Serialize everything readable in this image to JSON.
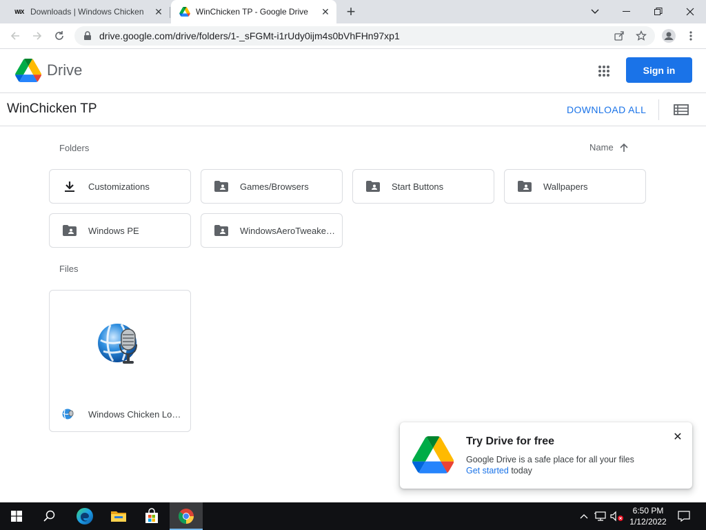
{
  "browser": {
    "tabs": [
      {
        "title": "Downloads | Windows Chicken",
        "favicon": "wix-favicon",
        "active": false
      },
      {
        "title": "WinChicken TP - Google Drive",
        "favicon": "google-drive-favicon",
        "active": true
      }
    ],
    "url": "drive.google.com/drive/folders/1-_sFGMt-i1rUdy0ijm4s0bVhFHn97xp1"
  },
  "drive": {
    "logo_text": "Drive",
    "signin_label": "Sign in",
    "folder_title": "WinChicken TP",
    "download_all_label": "DOWNLOAD ALL",
    "folders_label": "Folders",
    "files_label": "Files",
    "sort_label": "Name",
    "folders": [
      {
        "name": "Customizations",
        "icon": "download-icon"
      },
      {
        "name": "Games/Browsers",
        "icon": "shared-folder-icon"
      },
      {
        "name": "Start Buttons",
        "icon": "shared-folder-icon"
      },
      {
        "name": "Wallpapers",
        "icon": "shared-folder-icon"
      },
      {
        "name": "Windows PE",
        "icon": "shared-folder-icon"
      },
      {
        "name": "WindowsAeroTweake…",
        "icon": "shared-folder-icon"
      }
    ],
    "files": [
      {
        "name": "Windows Chicken Lo…",
        "icon": "globe-microphone-icon"
      }
    ]
  },
  "promo": {
    "title": "Try Drive for free",
    "body": "Google Drive is a safe place for all your files",
    "link": "Get started",
    "suffix": " today"
  },
  "taskbar": {
    "time": "6:50 PM",
    "date": "1/12/2022"
  },
  "colors": {
    "accent": "#1a73e8",
    "taskbar": "#101114"
  }
}
